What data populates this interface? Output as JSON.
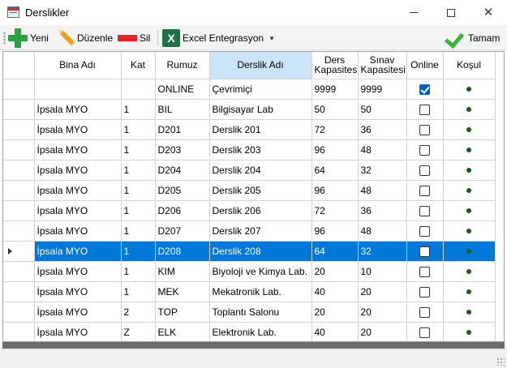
{
  "window": {
    "title": "Derslikler",
    "close_glyph": "✕"
  },
  "toolbar": {
    "new_label": "Yeni",
    "edit_label": "Düzenle",
    "delete_label": "Sil",
    "excel_label": "Excel Entegrasyon",
    "excel_glyph": "X",
    "dropdown_glyph": "▼",
    "done_label": "Tamam"
  },
  "grid": {
    "columns": [
      "",
      "Bina Adı",
      "Kat",
      "Rumuz",
      "Derslik Adı",
      "Ders Kapasitesi",
      "Sınav Kapasitesi",
      "Online",
      "Koşul"
    ],
    "sorted_column": "Derslik Adı",
    "selected_row": 8,
    "rows": [
      {
        "bina": "",
        "kat": "",
        "rumuz": "ONLINE",
        "ad": "Çevrimiçi",
        "ders": "9999",
        "sinav": "9999",
        "online": true,
        "kosul": true
      },
      {
        "bina": "İpsala MYO",
        "kat": "1",
        "rumuz": "BIL",
        "ad": "Bilgisayar Lab",
        "ders": "50",
        "sinav": "50",
        "online": false,
        "kosul": true
      },
      {
        "bina": "İpsala MYO",
        "kat": "1",
        "rumuz": "D201",
        "ad": "Derslik 201",
        "ders": "72",
        "sinav": "36",
        "online": false,
        "kosul": true
      },
      {
        "bina": "İpsala MYO",
        "kat": "1",
        "rumuz": "D203",
        "ad": "Derslik 203",
        "ders": "96",
        "sinav": "48",
        "online": false,
        "kosul": true
      },
      {
        "bina": "İpsala MYO",
        "kat": "1",
        "rumuz": "D204",
        "ad": "Derslik 204",
        "ders": "64",
        "sinav": "32",
        "online": false,
        "kosul": true
      },
      {
        "bina": "İpsala MYO",
        "kat": "1",
        "rumuz": "D205",
        "ad": "Derslik 205",
        "ders": "96",
        "sinav": "48",
        "online": false,
        "kosul": true
      },
      {
        "bina": "İpsala MYO",
        "kat": "1",
        "rumuz": "D206",
        "ad": "Derslik 206",
        "ders": "72",
        "sinav": "36",
        "online": false,
        "kosul": true
      },
      {
        "bina": "İpsala MYO",
        "kat": "1",
        "rumuz": "D207",
        "ad": "Derslik 207",
        "ders": "96",
        "sinav": "48",
        "online": false,
        "kosul": true
      },
      {
        "bina": "İpsala MYO",
        "kat": "1",
        "rumuz": "D208",
        "ad": "Derslik 208",
        "ders": "64",
        "sinav": "32",
        "online": false,
        "kosul": true
      },
      {
        "bina": "İpsala MYO",
        "kat": "1",
        "rumuz": "KIM",
        "ad": "Biyoloji ve Kimya Lab.",
        "ders": "20",
        "sinav": "10",
        "online": false,
        "kosul": true
      },
      {
        "bina": "İpsala MYO",
        "kat": "1",
        "rumuz": "MEK",
        "ad": "Mekatronik Lab.",
        "ders": "40",
        "sinav": "20",
        "online": false,
        "kosul": true
      },
      {
        "bina": "İpsala MYO",
        "kat": "2",
        "rumuz": "TOP",
        "ad": "Toplantı Salonu",
        "ders": "20",
        "sinav": "20",
        "online": false,
        "kosul": true
      },
      {
        "bina": "İpsala MYO",
        "kat": "Z",
        "rumuz": "ELK",
        "ad": "Elektronik Lab.",
        "ders": "40",
        "sinav": "20",
        "online": false,
        "kosul": true
      }
    ]
  }
}
